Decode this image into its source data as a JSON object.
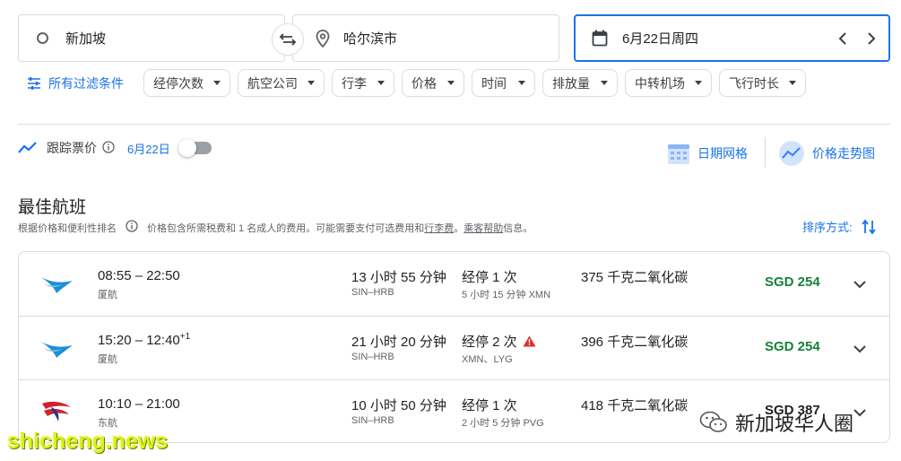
{
  "search": {
    "origin": "新加坡",
    "destination": "哈尔滨市",
    "date": "6月22日周四"
  },
  "filters": {
    "all_label": "所有过滤条件",
    "chips": [
      "经停次数",
      "航空公司",
      "行李",
      "价格",
      "时间",
      "排放量",
      "中转机场",
      "飞行时长"
    ]
  },
  "tracking": {
    "label": "跟踪票价",
    "date": "6月22日",
    "enabled": false
  },
  "views": {
    "grid_label": "日期网格",
    "graph_label": "价格走势图"
  },
  "results": {
    "title": "最佳航班",
    "subtitle": "根据价格和便利性排名",
    "price_note_1": "价格包含所需税费和 1 名成人的费用。可能需要支付可选费用和",
    "baggage_link": "行李费",
    "price_note_2": "。",
    "help_link": "乘客帮助",
    "price_note_3": "信息。",
    "sort_label": "排序方式:"
  },
  "flights": [
    {
      "times": "08:55 – 22:50",
      "plus": "",
      "airline": "厦航",
      "duration": "13 小时 55 分钟",
      "route": "SIN–HRB",
      "stops": "经停 1 次",
      "stop_detail": "5 小时 15 分钟 XMN",
      "warning": false,
      "co2": "375 千克二氧化碳",
      "price": "SGD 254"
    },
    {
      "times": "15:20 – 12:40",
      "plus": "+1",
      "airline": "厦航",
      "duration": "21 小时 20 分钟",
      "route": "SIN–HRB",
      "stops": "经停 2 次",
      "stop_detail": "XMN、LYG",
      "warning": true,
      "co2": "396 千克二氧化碳",
      "price": "SGD 254"
    },
    {
      "times": "10:10 – 21:00",
      "plus": "",
      "airline": "东航",
      "duration": "10 小时 50 分钟",
      "route": "SIN–HRB",
      "stops": "经停 1 次",
      "stop_detail": "2 小时 5 分钟 PVG",
      "warning": false,
      "co2": "418 千克二氧化碳",
      "price": "SGD 387"
    }
  ],
  "watermarks": {
    "left": "shicheng.news",
    "right": "新加坡华人圈"
  },
  "colors": {
    "accent": "#1a73e8",
    "price_green": "#188038",
    "warning_red": "#d93025",
    "xiamen_blue": "#1e8fd6",
    "eastern_red": "#d2202e",
    "eastern_blue": "#1b3d8f"
  }
}
